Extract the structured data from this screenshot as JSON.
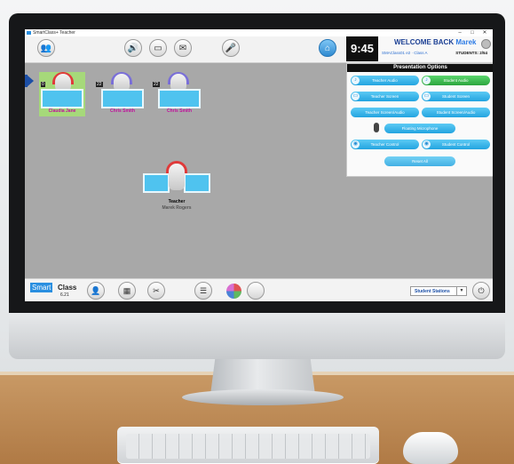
{
  "window": {
    "title": "SmartClass+ Teacher",
    "controls": [
      "–",
      "□",
      "✕"
    ]
  },
  "toolbar": {
    "icons": [
      "group-icon",
      "speaker-icon",
      "monitor-icon",
      "message-icon",
      "mic-icon",
      "home-icon"
    ]
  },
  "header": {
    "clock": "9:45",
    "welcome_prefix": "WELCOME BACK",
    "user_name": "Marek",
    "class_info": "SMAClass01 e2 · Class A",
    "students": "STUDENTS: 2/54"
  },
  "stations": [
    {
      "name": "Claudia Jane",
      "number": "0",
      "headset_color": "#e03a3a",
      "selected": true
    },
    {
      "name": "Chris Smith",
      "number": "22",
      "headset_color": "#7a6fd8",
      "selected": false
    },
    {
      "name": "Chris Smith",
      "number": "22",
      "headset_color": "#7a6fd8",
      "selected": false
    }
  ],
  "teacher": {
    "role": "Teacher",
    "name": "Marek Rogers",
    "headset_color": "#e03a3a"
  },
  "presentation": {
    "title": "Presentation Options",
    "buttons": [
      {
        "label": "Teacher Audio",
        "icon": "speaker-icon",
        "active": false
      },
      {
        "label": "Student Audio",
        "icon": "speaker-icon",
        "active": true
      },
      {
        "label": "Teacher Screen",
        "icon": "monitor-icon",
        "active": false
      },
      {
        "label": "Student Screen",
        "icon": "monitor-icon",
        "active": false
      },
      {
        "label": "Teacher Screen/Audio",
        "icon": "",
        "active": false
      },
      {
        "label": "Student Screen/Audio",
        "icon": "",
        "active": false
      },
      {
        "label": "Floating Microphone",
        "icon": "mic-icon",
        "active": false
      },
      {
        "label": "Teacher Control",
        "icon": "mouse-icon",
        "active": false
      },
      {
        "label": "Student Control",
        "icon": "mouse-icon",
        "active": false
      },
      {
        "label": "Reset All",
        "icon": "",
        "active": false
      }
    ],
    "accent": "#23a4e0",
    "active_color": "#2ba53d"
  },
  "bottombar": {
    "brand_smart": "Smart",
    "brand_class": "Class",
    "version": "6.21",
    "station_select": "Student Stations",
    "icons": [
      "user-icon",
      "grid-icon",
      "tools-icon",
      "list-icon",
      "color-cube-icon",
      "blank-circle-icon",
      "power-icon"
    ]
  }
}
